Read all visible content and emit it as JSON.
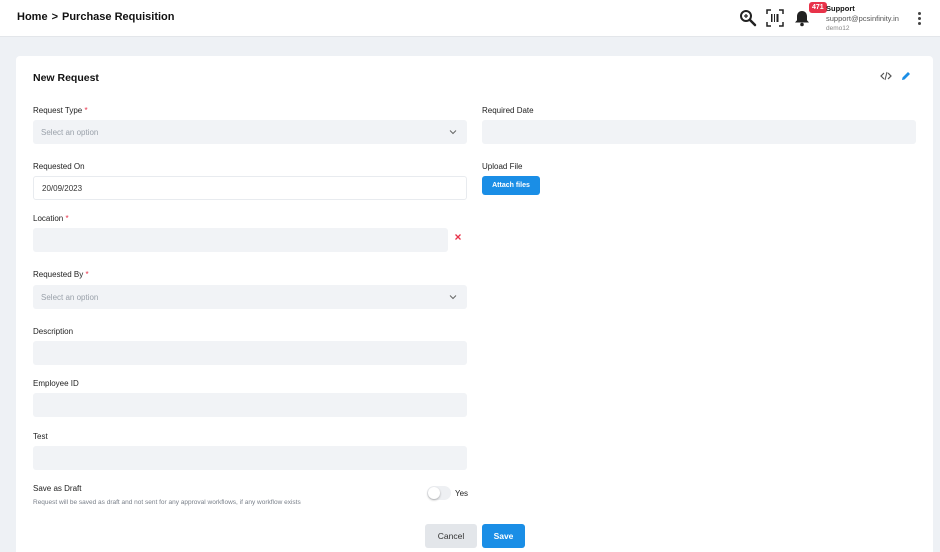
{
  "header": {
    "breadcrumb_home": "Home",
    "breadcrumb_sep": ">",
    "breadcrumb_current": "Purchase Requisition",
    "notification_count": "471",
    "user_name": "Support",
    "user_email": "support@pcsinfinity.in",
    "tenant": "demo12"
  },
  "icons": {
    "search": "search-icon",
    "barcode": "barcode-icon",
    "bell": "bell-icon",
    "kebab": "kebab-menu-icon",
    "code": "code-icon",
    "edit": "pencil-icon",
    "chevron": "chevron-down-icon",
    "clear": "close-icon"
  },
  "colors": {
    "accent": "#1a8ee6",
    "required": "#e8334a",
    "badge": "#e8334a"
  },
  "form": {
    "title": "New Request",
    "request_type": {
      "label": "Request Type",
      "required": "*",
      "placeholder": "Select an option"
    },
    "required_date": {
      "label": "Required Date",
      "value": ""
    },
    "requested_on": {
      "label": "Requested On",
      "value": "20/09/2023"
    },
    "upload_file": {
      "label": "Upload File",
      "button": "Attach files"
    },
    "location": {
      "label": "Location",
      "required": "*",
      "value": ""
    },
    "requested_by": {
      "label": "Requested By",
      "required": "*",
      "placeholder": "Select an option"
    },
    "description": {
      "label": "Description",
      "value": ""
    },
    "employee_id": {
      "label": "Employee ID",
      "value": ""
    },
    "test": {
      "label": "Test",
      "value": ""
    },
    "save_as_draft": {
      "label": "Save as Draft",
      "hint": "Request will be saved as draft and not sent for any approval workflows, if any workflow exists",
      "toggle_label": "Yes",
      "checked": false
    },
    "cancel_label": "Cancel",
    "save_label": "Save"
  }
}
